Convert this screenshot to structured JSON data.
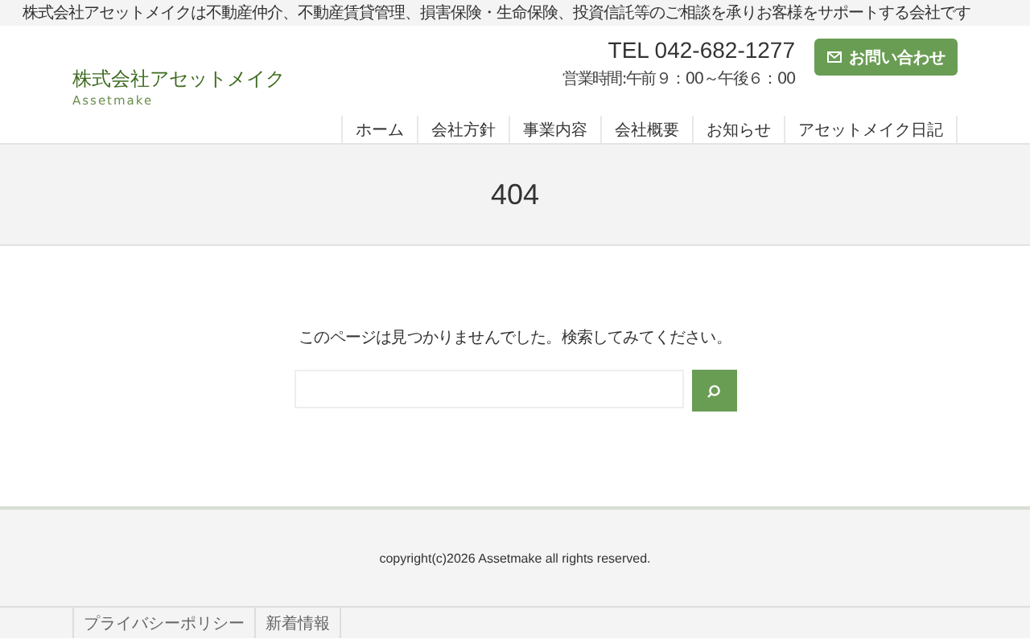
{
  "top_bar": {
    "tagline": "株式会社アセットメイクは不動産仲介、不動産賃貸管理、損害保険・生命保険、投資信託等のご相談を承りお客様をサポートする会社です"
  },
  "header": {
    "logo": "株式会社アセットメイク",
    "logo_sub": "Assetmake",
    "tel": "TEL 042-682-1277",
    "hours": "営業時間:午前９：00～午後６：00",
    "contact_button": "お問い合わせ"
  },
  "nav": [
    {
      "label": "ホーム"
    },
    {
      "label": "会社方針"
    },
    {
      "label": "事業内容"
    },
    {
      "label": "会社概要"
    },
    {
      "label": "お知らせ"
    },
    {
      "label": "アセットメイク日記"
    }
  ],
  "page_title": "404",
  "message": "このページは見つかりませんでした。検索してみてください。",
  "footer": {
    "copyright": "copyright(c)2026 Assetmake all rights reserved.",
    "links": [
      {
        "label": "プライバシーポリシー"
      },
      {
        "label": "新着情報"
      }
    ]
  }
}
